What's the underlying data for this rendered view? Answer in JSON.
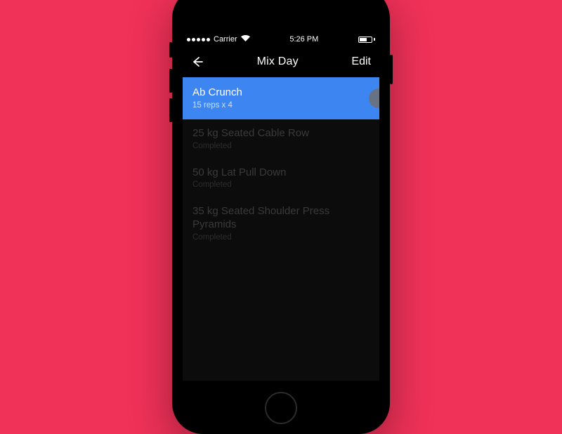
{
  "statusbar": {
    "carrier": "Carrier",
    "time": "5:26 PM"
  },
  "navbar": {
    "title": "Mix Day",
    "edit": "Edit"
  },
  "exercises": [
    {
      "name": "Ab Crunch",
      "subtitle": "15 reps x 4",
      "active": true
    },
    {
      "name": "25 kg Seated Cable Row",
      "subtitle": "Completed",
      "active": false
    },
    {
      "name": "50 kg Lat Pull Down",
      "subtitle": "Completed",
      "active": false
    },
    {
      "name": "35 kg Seated Shoulder Press Pyramids",
      "subtitle": "Completed",
      "active": false
    }
  ],
  "colors": {
    "background": "#f03158",
    "accent": "#3d86f2"
  }
}
